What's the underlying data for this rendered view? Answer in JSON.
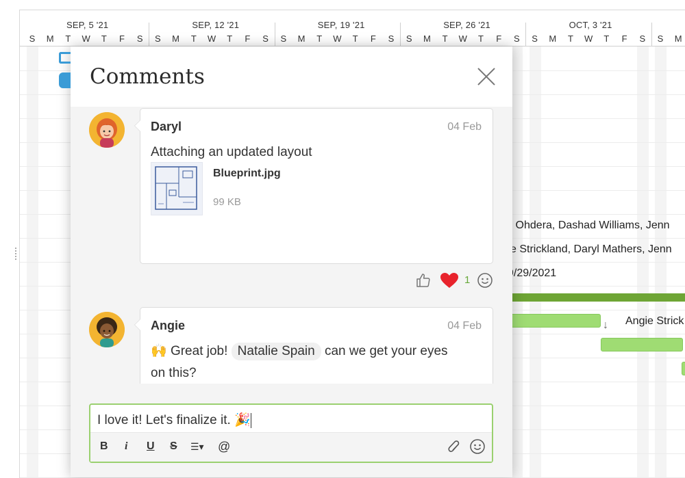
{
  "gantt": {
    "weeks": [
      "SEP, 5 '21",
      "SEP, 12 '21",
      "SEP, 19 '21",
      "SEP, 26 '21",
      "OCT, 3 '21"
    ],
    "days": [
      "S",
      "M",
      "T",
      "W",
      "T",
      "F",
      "S",
      "S",
      "M",
      "T",
      "W",
      "T",
      "F",
      "S",
      "S",
      "M",
      "T",
      "W",
      "T",
      "F",
      "S",
      "S",
      "M",
      "T",
      "W",
      "T",
      "F",
      "S",
      "S",
      "M",
      "T",
      "W",
      "T",
      "F",
      "S",
      "S",
      "M"
    ],
    "row_text": {
      "assignees_1": "ll Ohdera, Dashad Williams, Jenn",
      "assignees_2": "e Strickland, Daryl Mathers, Jenn",
      "date": "9/29/2021",
      "task_label": "Angie Strick"
    },
    "colors": {
      "summary": "#6ea535",
      "task": "#9fdc73"
    }
  },
  "modal": {
    "title": "Comments",
    "comments": [
      {
        "author": "Daryl",
        "date": "04 Feb",
        "text": "Attaching an updated layout",
        "attachment": {
          "name": "Blueprint.jpg",
          "size": "99 KB"
        },
        "reactions": {
          "heart_count": "1"
        }
      },
      {
        "author": "Angie",
        "date": "04 Feb",
        "emoji": "🙌",
        "text_before": "Great job!",
        "mention": "Natalie  Spain",
        "text_after": "can we get your eyes",
        "text_line2": "on this?"
      }
    ],
    "composer": {
      "value": "I love it! Let's finalize it.",
      "emoji": "🎉",
      "toolbar": {
        "bold": "B",
        "italic": "i",
        "underline": "U",
        "strike": "S",
        "list": "☰▾",
        "mention": "@"
      }
    }
  }
}
